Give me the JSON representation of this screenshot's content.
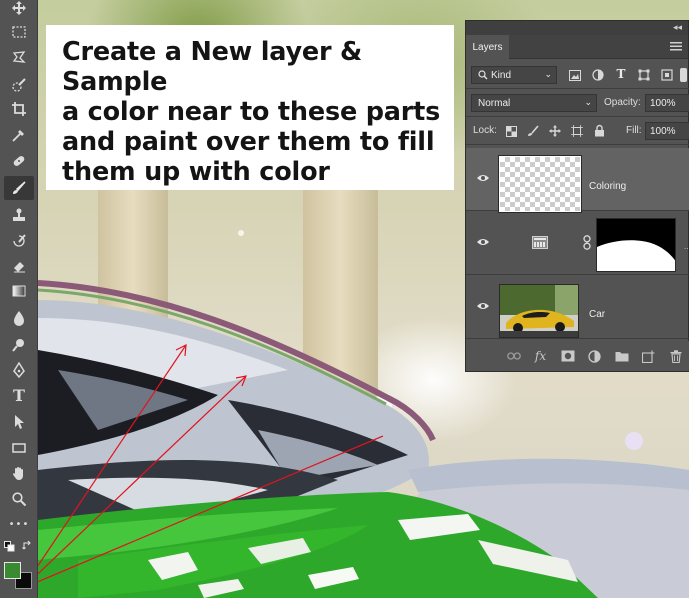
{
  "annotation": {
    "lines": [
      "Create a New layer & Sample",
      "a color near to these parts",
      "and paint over them to fill",
      "them up with color"
    ],
    "arrow_color": "#e0141e"
  },
  "toolbar": {
    "tools": [
      "move-tool",
      "marquee-tool",
      "lasso-tool",
      "quick-selection-tool",
      "crop-tool",
      "eyedropper-tool",
      "healing-brush-tool",
      "brush-tool",
      "clone-stamp-tool",
      "history-brush-tool",
      "eraser-tool",
      "gradient-tool",
      "blur-tool",
      "dodge-tool",
      "pen-tool",
      "type-tool",
      "path-selection-tool",
      "rectangle-tool",
      "hand-tool",
      "zoom-tool",
      "more-tools"
    ],
    "active_tool": "brush-tool",
    "type_glyph": "T",
    "more_glyph": "•••",
    "foreground_color": "#3a8a32",
    "background_color": "#0a0a0a"
  },
  "layers_panel": {
    "tab_label": "Layers",
    "collapse_glyph": "◂◂",
    "filter_kind": "Kind",
    "blend_mode": "Normal",
    "opacity_label": "Opacity:",
    "opacity_value": "100%",
    "lock_label": "Lock:",
    "fill_label": "Fill:",
    "fill_value": "100%",
    "fx_label": "fx",
    "layers": [
      {
        "name": "Coloring",
        "selected": true,
        "visible": true
      },
      {
        "name": "",
        "selected": false,
        "visible": true,
        "type": "adjustment-with-mask"
      },
      {
        "name": "Car",
        "selected": false,
        "visible": true
      }
    ]
  }
}
